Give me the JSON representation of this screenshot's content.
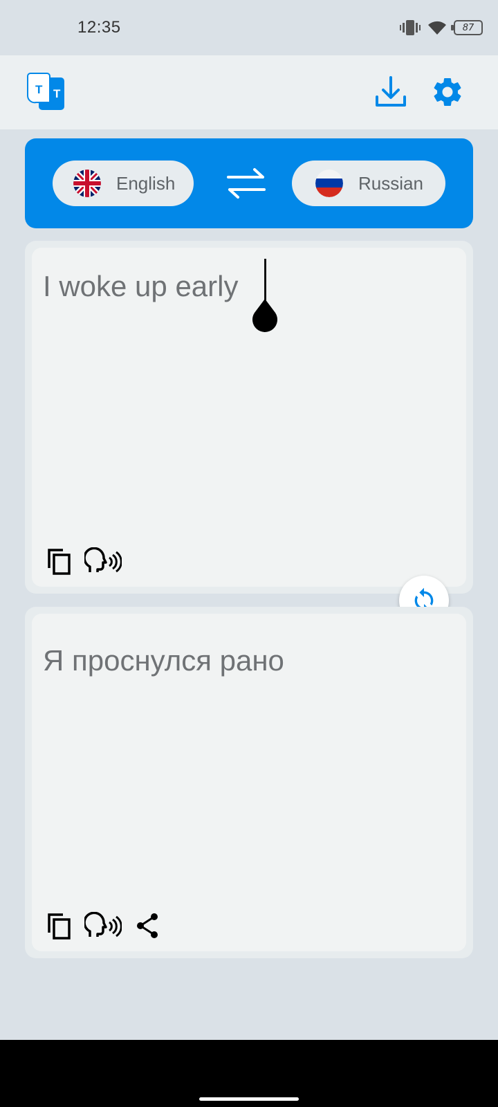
{
  "status_bar": {
    "time": "12:35",
    "battery_level": "87",
    "icons": [
      "vibrate-icon",
      "wifi-icon",
      "battery-icon"
    ]
  },
  "header": {
    "logo_letters": [
      "T",
      "T"
    ],
    "actions": [
      "download-icon",
      "settings-icon"
    ]
  },
  "languages": {
    "source": {
      "label": "English",
      "flag": "uk-flag"
    },
    "target": {
      "label": "Russian",
      "flag": "russia-flag"
    },
    "swap_icon": "swap-arrows-icon"
  },
  "source_card": {
    "text": "I woke up early",
    "actions": [
      "copy-icon",
      "speak-icon"
    ]
  },
  "target_card": {
    "text": "Я проснулся рано",
    "actions": [
      "copy-icon",
      "speak-icon",
      "share-icon"
    ]
  },
  "colors": {
    "accent": "#0288e8",
    "background": "#dae1e7",
    "card": "#f1f3f3"
  }
}
